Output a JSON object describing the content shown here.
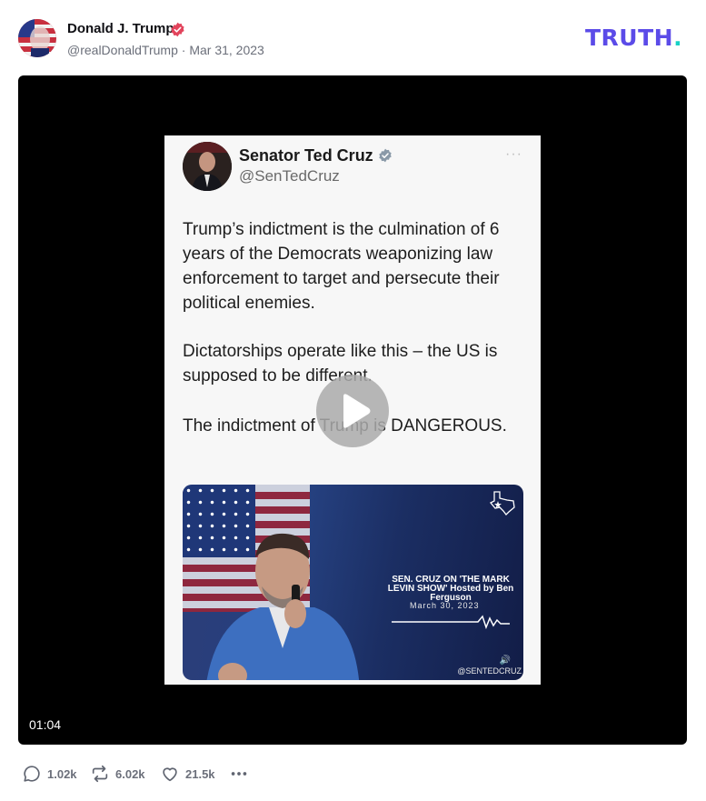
{
  "post": {
    "author_name": "Donald J. Trump",
    "handle": "@realDonaldTrump",
    "separator": "·",
    "date": "Mar 31, 2023",
    "brand": "TRUTH",
    "brand_dot": "."
  },
  "video": {
    "duration": "01:04",
    "play_icon": "play-icon"
  },
  "embedded_tweet": {
    "name": "Senator Ted Cruz",
    "handle": "@SenTedCruz",
    "more": "···",
    "paragraph_1": "Trump’s indictment is the culmination of 6 years of the Democrats weaponizing law enforcement to target and persecute their political enemies.",
    "paragraph_2": "Dictatorships operate like this – the US is supposed to be different.",
    "paragraph_3": "The indictment of Trump is DANGEROUS.",
    "image_caption": "SEN. CRUZ ON 'THE MARK LEVIN SHOW' Hosted by Ben Ferguson",
    "image_date": "March 30, 2023",
    "image_watermark": "@SENTEDCRUZ"
  },
  "actions": {
    "replies": "1.02k",
    "retruths": "6.02k",
    "likes": "21.5k"
  },
  "colors": {
    "brand": "#5b4be8",
    "brand_accent": "#17d1c6",
    "verified": "#e2445c",
    "muted_text": "#6b6f7a"
  }
}
